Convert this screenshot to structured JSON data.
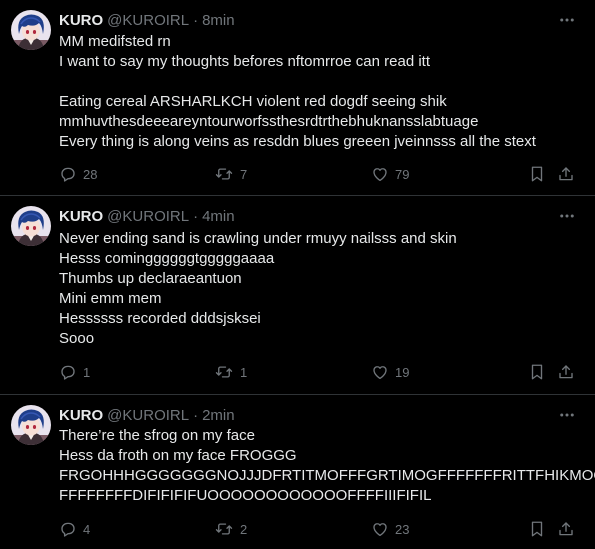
{
  "tweets": [
    {
      "name": "KURO",
      "handle": "@KUROIRL",
      "separator": "·",
      "time": "8min",
      "lines": [
        "MM medifsted rn",
        "I want to say my thoughts befores nftomrroe can read itt",
        "",
        "Eating cereal ARSHARLKCH violent red dogdf seeing shik",
        "mmhuvthesdeeeareyntourworfssthesrdtrthebhuknansslabtuage",
        "Every thing is along veins as resddn blues greeen jveinnsss all the stext"
      ],
      "replies": "28",
      "reposts": "7",
      "likes": "79"
    },
    {
      "name": "KURO",
      "handle": "@KUROIRL",
      "separator": "·",
      "time": "4min",
      "lines": [
        "Never ending sand is crawling under rmuyy nailsss and skin",
        "Hesss cominggggggtgggggaaaa",
        "Thumbs up declaraeantuon",
        "Mini emm mem",
        "Hessssss recorded dddsjsksei",
        "Sooo"
      ],
      "replies": "1",
      "reposts": "1",
      "likes": "19"
    },
    {
      "name": "KURO",
      "handle": "@KUROIRL",
      "separator": "·",
      "time": "2min",
      "lines": [
        "There’re the sfrog on my face",
        "Hess da froth on my face FROGGG",
        "FRGOHHHGGGGGGGNOJJJDFRTITMOFFFGRTIMOGFFFFFFFRITTFHIKMOO",
        "FFFFFFFFDIFIFIFIFUOOOOOOOOOOOOFFFFIIIFIFIL"
      ],
      "replies": "4",
      "reposts": "2",
      "likes": "23"
    }
  ],
  "icons": {
    "avatar": "anime-avatar",
    "more": "more-horizontal-icon",
    "reply": "reply-icon",
    "repost": "repost-icon",
    "like": "heart-icon",
    "bookmark": "bookmark-icon",
    "share": "share-icon"
  },
  "colors": {
    "background": "#000000",
    "text": "#e7e9ea",
    "secondary": "#71767b",
    "divider": "#2f3336"
  }
}
